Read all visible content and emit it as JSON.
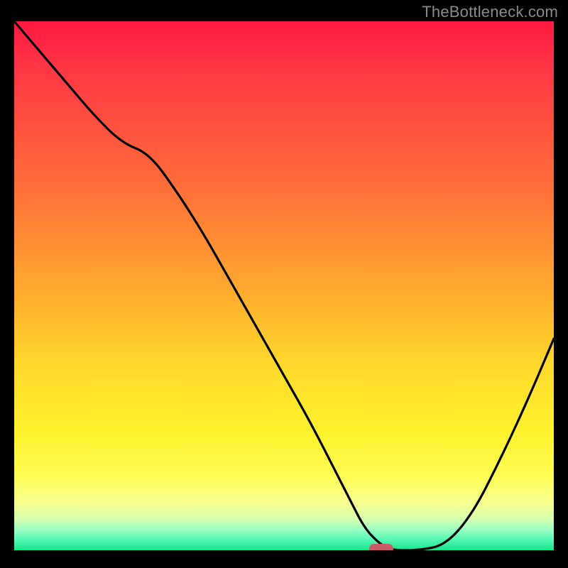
{
  "attribution": "TheBottleneck.com",
  "colors": {
    "frame": "#000000",
    "marker": "#c85a63",
    "curve": "#000000",
    "gradient_stops": [
      "#ff193f",
      "#ff3446",
      "#ff6a3a",
      "#ffa72f",
      "#ffd92b",
      "#fff22e",
      "#fffd55",
      "#f8ff8e",
      "#d7ffb0",
      "#9effc2",
      "#55f7b4",
      "#16e48b"
    ]
  },
  "chart_data": {
    "type": "line",
    "title": "",
    "xlabel": "",
    "ylabel": "",
    "xlim": [
      0,
      100
    ],
    "ylim": [
      0,
      100
    ],
    "x": [
      0,
      5,
      10,
      15,
      20,
      25,
      30,
      35,
      40,
      45,
      50,
      55,
      60,
      62,
      65,
      68,
      70,
      75,
      80,
      85,
      90,
      95,
      100
    ],
    "values": [
      100,
      94,
      88,
      82,
      77,
      75,
      68,
      60,
      51,
      42,
      33,
      24,
      14,
      10,
      4,
      1,
      0,
      0,
      1,
      7,
      17,
      28,
      40
    ],
    "marker_x": 68,
    "marker_y": 0,
    "grid": false,
    "legend": false
  }
}
